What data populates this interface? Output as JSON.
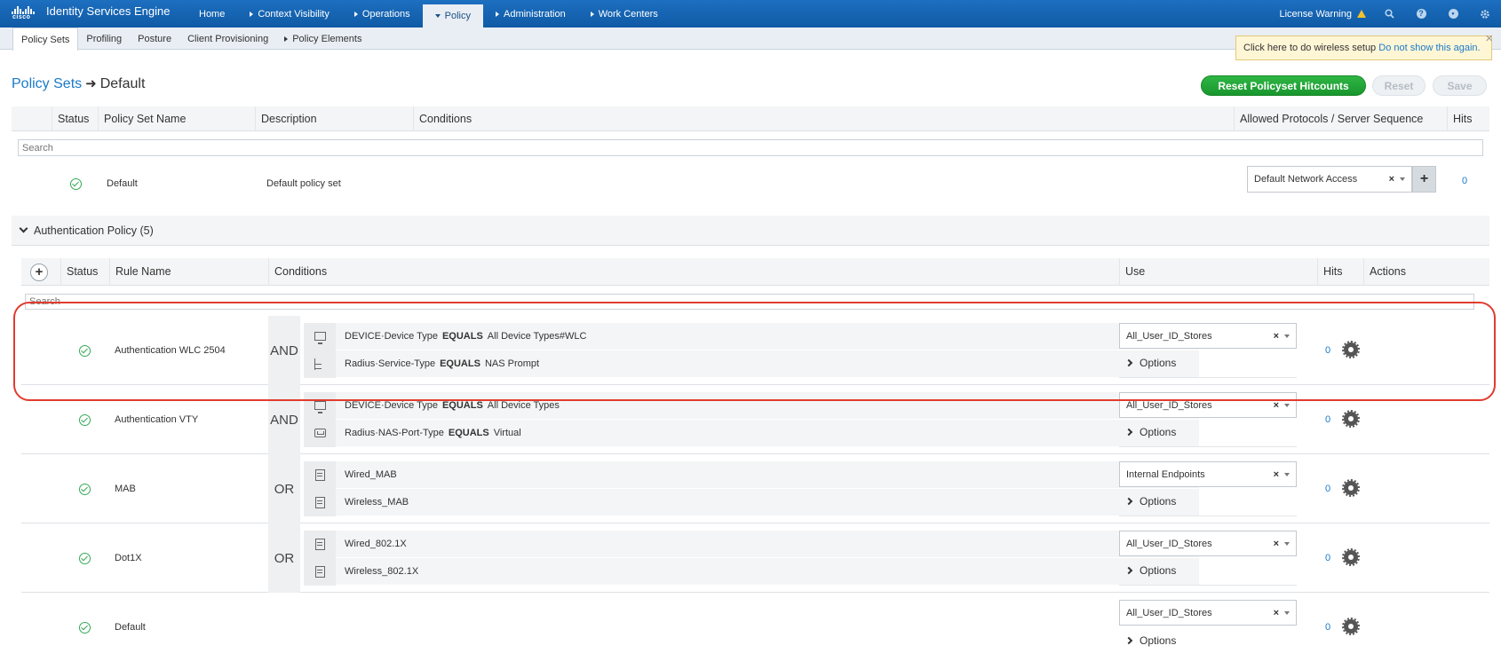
{
  "app": {
    "logo_text": "cisco",
    "title": "Identity Services Engine"
  },
  "main_nav": [
    {
      "label": "Home",
      "caret": ""
    },
    {
      "label": "Context Visibility",
      "caret": "right"
    },
    {
      "label": "Operations",
      "caret": "right"
    },
    {
      "label": "Policy",
      "caret": "down",
      "active": true
    },
    {
      "label": "Administration",
      "caret": "right"
    },
    {
      "label": "Work Centers",
      "caret": "right"
    }
  ],
  "top_right": {
    "license_label": "License Warning",
    "icons": [
      "search-icon",
      "help-icon",
      "notification-icon",
      "gear-icon"
    ]
  },
  "sub_nav": [
    {
      "label": "Policy Sets",
      "active": true
    },
    {
      "label": "Profiling"
    },
    {
      "label": "Posture"
    },
    {
      "label": "Client Provisioning"
    },
    {
      "label": "Policy Elements",
      "caret": "right"
    }
  ],
  "popup": {
    "text": "Click here to do wireless setup",
    "link": "Do not show this again.",
    "close": "×"
  },
  "breadcrumb": {
    "parent": "Policy Sets",
    "arrow": "➜",
    "current": "Default"
  },
  "buttons": {
    "reset_hitcounts": "Reset Policyset Hitcounts",
    "reset": "Reset",
    "save": "Save"
  },
  "policy_sets_table": {
    "headers": [
      "Status",
      "Policy Set Name",
      "Description",
      "Conditions",
      "Allowed Protocols / Server Sequence",
      "Hits"
    ],
    "search_placeholder": "Search",
    "row": {
      "name": "Default",
      "description": "Default policy set",
      "protocol": "Default Network Access",
      "clear": "×",
      "add": "+",
      "hits": "0"
    }
  },
  "auth_section": {
    "title": "Authentication Policy (5)"
  },
  "auth_table": {
    "headers": [
      "Status",
      "Rule Name",
      "Conditions",
      "Use",
      "Hits",
      "Actions"
    ],
    "add": "+",
    "search_placeholder": "Search",
    "options_label": "Options",
    "clear": "×",
    "rules": [
      {
        "name": "Authentication WLC 2504",
        "operator": "AND",
        "use": "All_User_ID_Stores",
        "hits": "0",
        "conditions": [
          {
            "icon": "monitor",
            "attr": "DEVICE·Device Type",
            "op": "EQUALS",
            "value": "All Device Types#WLC"
          },
          {
            "icon": "tree",
            "attr": "Radius·Service-Type",
            "op": "EQUALS",
            "value": "NAS Prompt"
          }
        ]
      },
      {
        "name": "Authentication VTY",
        "operator": "AND",
        "use": "All_User_ID_Stores",
        "hits": "0",
        "conditions": [
          {
            "icon": "monitor",
            "attr": "DEVICE·Device Type",
            "op": "EQUALS",
            "value": "All Device Types"
          },
          {
            "icon": "port",
            "attr": "Radius·NAS-Port-Type",
            "op": "EQUALS",
            "value": "Virtual"
          }
        ]
      },
      {
        "name": "MAB",
        "operator": "OR",
        "use": "Internal Endpoints",
        "hits": "0",
        "conditions": [
          {
            "icon": "doc",
            "attr": "Wired_MAB",
            "op": "",
            "value": ""
          },
          {
            "icon": "doc",
            "attr": "Wireless_MAB",
            "op": "",
            "value": ""
          }
        ]
      },
      {
        "name": "Dot1X",
        "operator": "OR",
        "use": "All_User_ID_Stores",
        "hits": "0",
        "conditions": [
          {
            "icon": "doc",
            "attr": "Wired_802.1X",
            "op": "",
            "value": ""
          },
          {
            "icon": "doc",
            "attr": "Wireless_802.1X",
            "op": "",
            "value": ""
          }
        ]
      },
      {
        "name": "Default",
        "operator": "",
        "use": "All_User_ID_Stores",
        "hits": "0",
        "conditions": []
      }
    ]
  },
  "colors": {
    "topbar": "#1565b5",
    "accent_link": "#1a7ac8",
    "green_button": "#22a63a",
    "status_ok": "#34a853",
    "highlight": "#e23b2e"
  }
}
